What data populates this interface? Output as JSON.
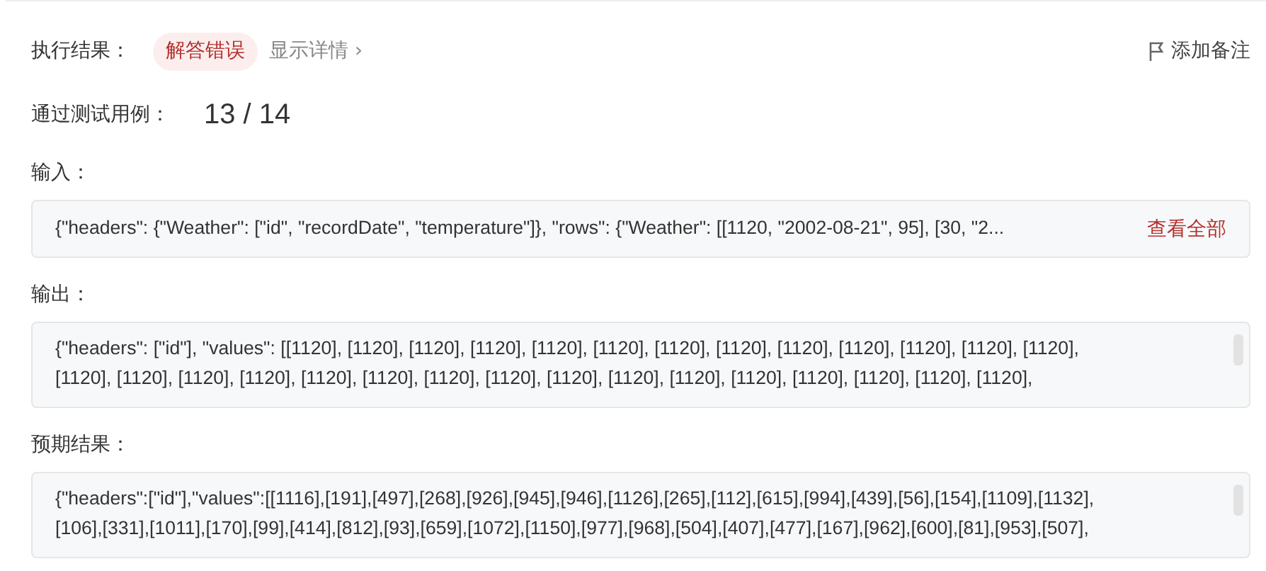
{
  "result": {
    "label": "执行结果：",
    "status": "解答错误",
    "details_link": "显示详情 ›",
    "add_note": "添加备注"
  },
  "passed": {
    "label": "通过测试用例：",
    "value": "13 / 14"
  },
  "sections": [
    {
      "label": "输入：",
      "kind": "truncated",
      "lines": [
        "{\"headers\": {\"Weather\": [\"id\", \"recordDate\", \"temperature\"]}, \"rows\": {\"Weather\": [[1120, \"2002-08-21\", 95], [30, \"2..."
      ],
      "action": "查看全部"
    },
    {
      "label": "输出：",
      "kind": "scroll",
      "lines": [
        "{\"headers\": [\"id\"], \"values\": [[1120], [1120], [1120], [1120], [1120], [1120], [1120], [1120], [1120], [1120], [1120], [1120], [1120],",
        "[1120], [1120], [1120], [1120], [1120], [1120], [1120], [1120], [1120], [1120], [1120], [1120], [1120], [1120], [1120], [1120],"
      ]
    },
    {
      "label": "预期结果：",
      "kind": "scroll",
      "lines": [
        "{\"headers\":[\"id\"],\"values\":[[1116],[191],[497],[268],[926],[945],[946],[1126],[265],[112],[615],[994],[439],[56],[154],[1109],[1132],",
        "[106],[331],[1011],[170],[99],[414],[812],[93],[659],[1072],[1150],[977],[968],[504],[407],[477],[167],[962],[600],[81],[953],[507],"
      ]
    }
  ]
}
